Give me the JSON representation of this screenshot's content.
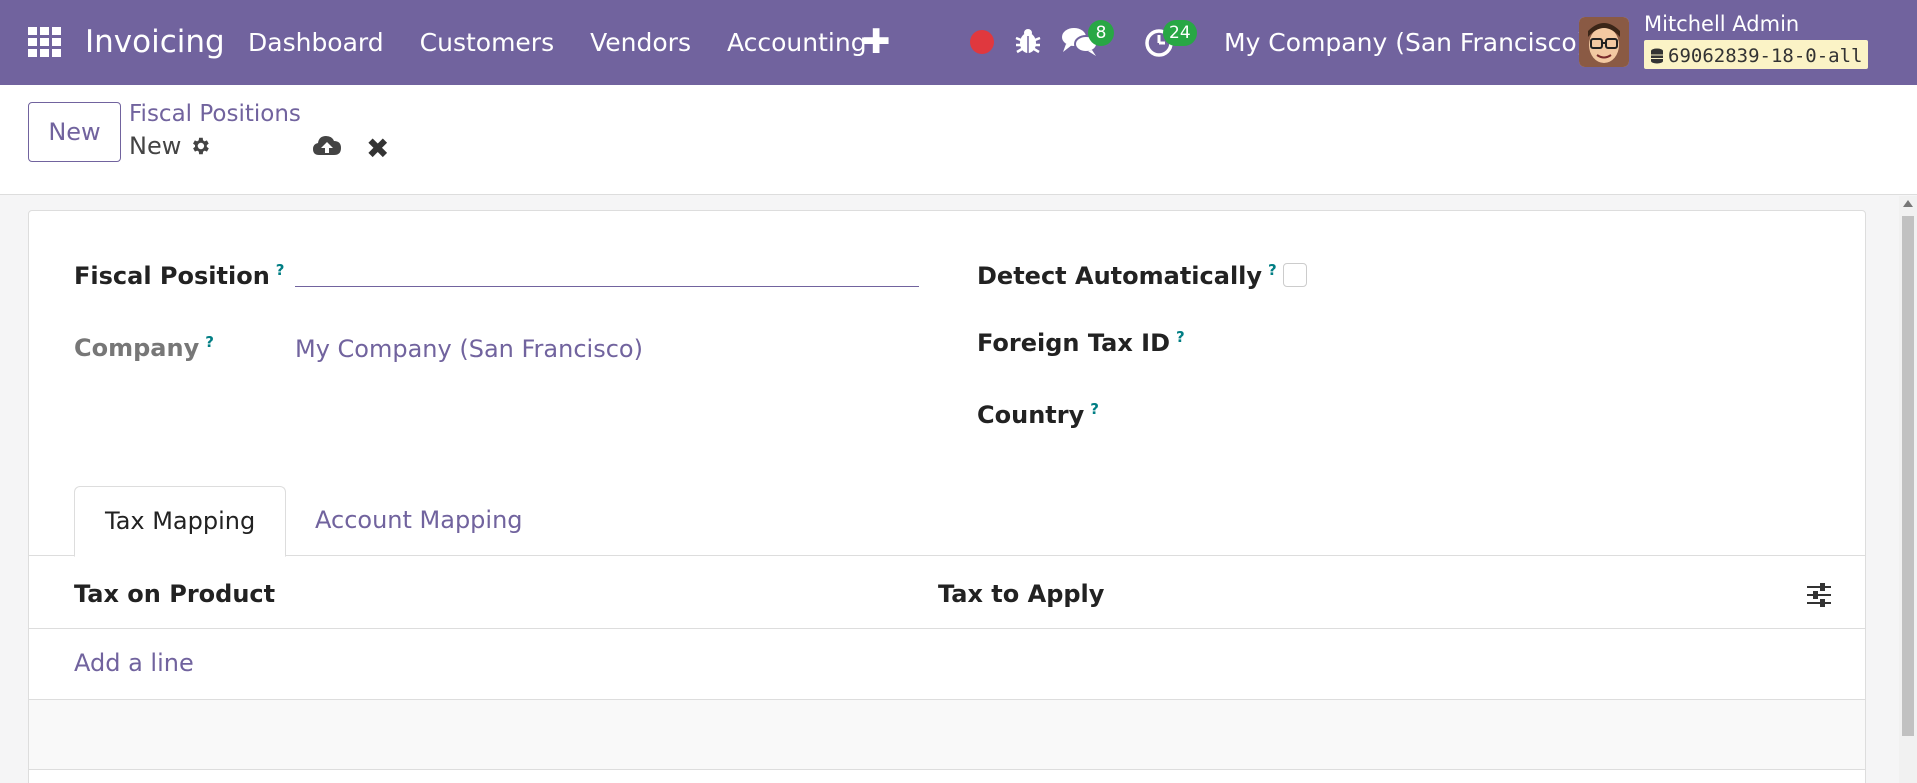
{
  "navbar": {
    "brand": "Invoicing",
    "menu": [
      "Dashboard",
      "Customers",
      "Vendors",
      "Accounting"
    ],
    "plus": "✚",
    "chat_count": "8",
    "activity_count": "24",
    "company": "My Company (San Francisco)",
    "user_name": "Mitchell Admin",
    "db_name": "69062839-18-0-all",
    "colors": {
      "bg": "#71639e",
      "badge": "#28a745",
      "record": "#e0383e"
    }
  },
  "control_panel": {
    "new_label": "New",
    "breadcrumb_parent": "Fiscal Positions",
    "breadcrumb_current": "New",
    "discard": "✖"
  },
  "form": {
    "fiscal_position_label": "Fiscal Position",
    "fiscal_position_value": "",
    "company_label": "Company",
    "company_value": "My Company (San Francisco)",
    "detect_label": "Detect Automatically",
    "foreign_tax_label": "Foreign Tax ID",
    "country_label": "Country",
    "help": "?"
  },
  "tabs": [
    {
      "label": "Tax Mapping",
      "active": true
    },
    {
      "label": "Account Mapping",
      "active": false
    }
  ],
  "table": {
    "columns": [
      "Tax on Product",
      "Tax to Apply"
    ],
    "add_line": "Add a line"
  }
}
